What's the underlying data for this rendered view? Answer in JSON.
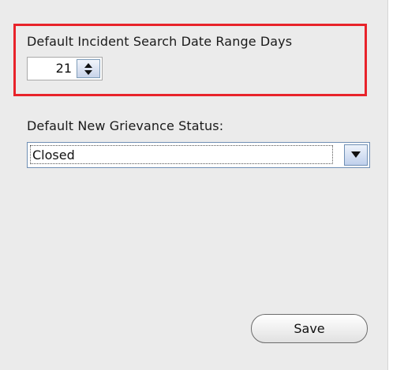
{
  "settings": {
    "search_range": {
      "label": "Default Incident Search Date Range Days",
      "value": "21"
    },
    "grievance_status": {
      "label": "Default New Grievance Status:",
      "selected": "Closed"
    }
  },
  "actions": {
    "save_label": "Save"
  },
  "icons": {
    "spinner": "up-down-arrows-icon",
    "dropdown": "chevron-down-icon"
  },
  "colors": {
    "highlight_border": "#e8232a",
    "panel_background": "#ebebeb",
    "control_accent": "#6f8fb4"
  }
}
